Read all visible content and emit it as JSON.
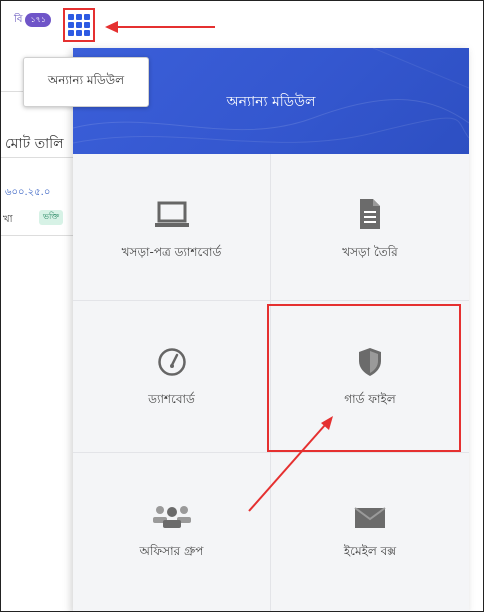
{
  "topbar": {
    "badge_text": "বি",
    "badge_count": "১৭১",
    "grid_button_icon": "apps-grid-icon"
  },
  "tooltip": {
    "text": "অন্যান্য মডিউল"
  },
  "background": {
    "header_fragment": "মোট তালি",
    "number_fragment": "৬০০.২৫.০",
    "text_fragment": "খা",
    "tag_fragment": "ভক্তি"
  },
  "panel": {
    "title": "অন্যান্য মডিউল",
    "tiles": [
      {
        "label": "খসড়া-পত্র ড্যাশবোর্ড",
        "icon": "laptop-icon"
      },
      {
        "label": "খসড়া তৈরি",
        "icon": "document-icon"
      },
      {
        "label": "ড্যাশবোর্ড",
        "icon": "speedometer-icon"
      },
      {
        "label": "গার্ড ফাইল",
        "icon": "shield-icon"
      },
      {
        "label": "অফিসার গ্রুপ",
        "icon": "users-group-icon"
      },
      {
        "label": "ইমেইল বক্স",
        "icon": "envelope-icon"
      }
    ]
  },
  "colors": {
    "panel_header": "#3457cf",
    "annotation_red": "#e53030",
    "grid_icon_blue": "#2d5be3"
  }
}
